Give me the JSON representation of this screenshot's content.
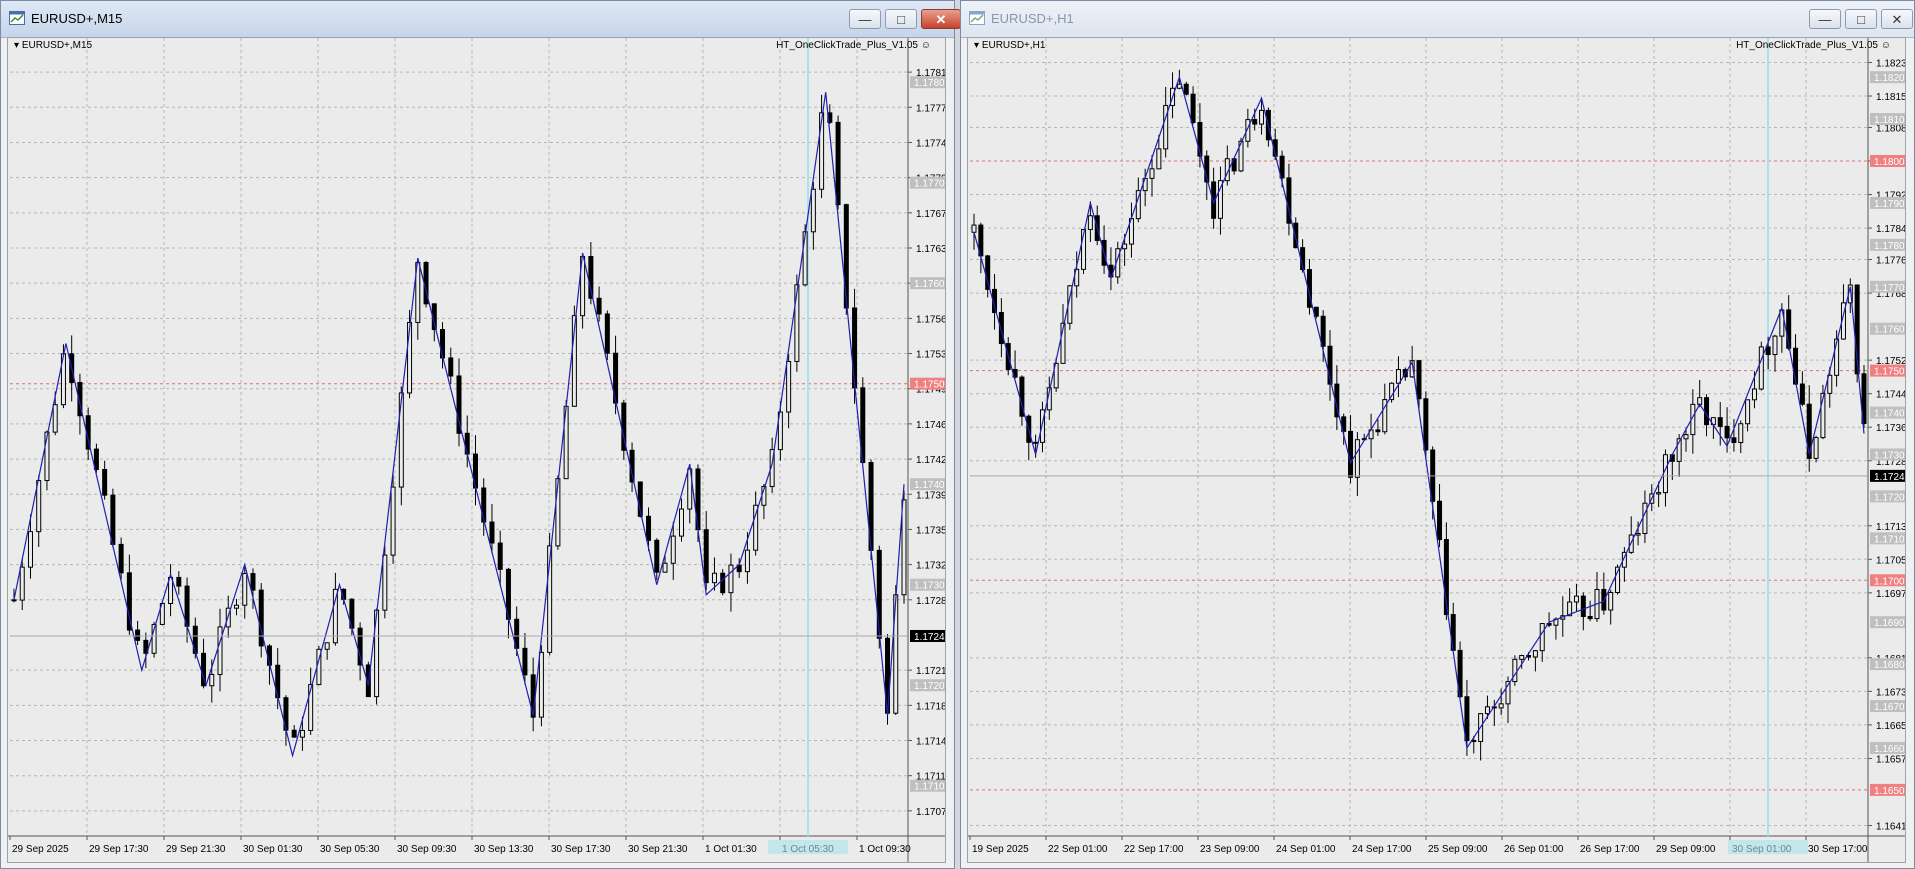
{
  "windows": [
    {
      "title": "EURUSD+,M15",
      "symbol_label": "EURUSD+,M15",
      "ea_label": "HT_OneClickTrade_Plus_V1.05 ☺",
      "active": true,
      "price_labels": [
        "1.17810",
        "1.17775",
        "1.17740",
        "1.17705",
        "1.17670",
        "1.17635",
        "1.17600",
        "1.17565",
        "1.17530",
        "1.17495",
        "1.17460",
        "1.17425",
        "1.17390",
        "1.17355",
        "1.17320",
        "1.17285",
        "1.17215",
        "1.17180",
        "1.17145",
        "1.17110",
        "1.17075"
      ],
      "round_levels": [
        "1.17800",
        "1.17700",
        "1.17600",
        "1.17400",
        "1.17300",
        "1.17200",
        "1.17100"
      ],
      "highlight_level": "1.17500",
      "current_price": "1.17249",
      "time_labels": [
        "29 Sep 2025",
        "29 Sep 17:30",
        "29 Sep 21:30",
        "30 Sep 01:30",
        "30 Sep 05:30",
        "30 Sep 09:30",
        "30 Sep 13:30",
        "30 Sep 17:30",
        "30 Sep 21:30",
        "1 Oct 01:30",
        "1 Oct 05:30",
        "1 Oct 09:30"
      ],
      "chart_data": {
        "type": "line",
        "ylim": [
          1.1705,
          1.1783
        ],
        "zigzag": [
          {
            "x": 0.0,
            "y": 1.17285
          },
          {
            "x": 6.3,
            "y": 1.1754
          },
          {
            "x": 15.5,
            "y": 1.17215
          },
          {
            "x": 19.0,
            "y": 1.1731
          },
          {
            "x": 23.3,
            "y": 1.172
          },
          {
            "x": 28.0,
            "y": 1.1732
          },
          {
            "x": 33.8,
            "y": 1.1713
          },
          {
            "x": 39.5,
            "y": 1.173
          },
          {
            "x": 43.0,
            "y": 1.172
          },
          {
            "x": 49.0,
            "y": 1.17625
          },
          {
            "x": 63.0,
            "y": 1.1717
          },
          {
            "x": 69.0,
            "y": 1.1763
          },
          {
            "x": 78.0,
            "y": 1.173
          },
          {
            "x": 82.0,
            "y": 1.1742
          },
          {
            "x": 84.0,
            "y": 1.1729
          },
          {
            "x": 88.0,
            "y": 1.1732
          },
          {
            "x": 92.0,
            "y": 1.1742
          },
          {
            "x": 98.5,
            "y": 1.1779
          },
          {
            "x": 106.0,
            "y": 1.1717
          },
          {
            "x": 108.0,
            "y": 1.174
          }
        ]
      }
    },
    {
      "title": "EURUSD+,H1",
      "symbol_label": "EURUSD+,H1",
      "ea_label": "HT_OneClickTrade_Plus_V1.05 ☺",
      "active": false,
      "price_labels": [
        "1.18235",
        "1.18155",
        "1.18080",
        "1.18000",
        "1.17920",
        "1.17840",
        "1.17765",
        "1.17685",
        "1.17525",
        "1.17445",
        "1.17365",
        "1.17285",
        "1.17130",
        "1.17050",
        "1.16970",
        "1.16815",
        "1.16735",
        "1.16655",
        "1.16575",
        "1.16415"
      ],
      "round_levels": [
        "1.18200",
        "1.18100",
        "1.17900",
        "1.17800",
        "1.17700",
        "1.17600",
        "1.17400",
        "1.17300",
        "1.17200",
        "1.17100",
        "1.16900",
        "1.16800",
        "1.16700",
        "1.16600"
      ],
      "highlight_levels": [
        "1.18000",
        "1.17500",
        "1.17000",
        "1.16500"
      ],
      "current_price": "1.17249",
      "time_labels": [
        "19 Sep 2025",
        "22 Sep 01:00",
        "22 Sep 17:00",
        "23 Sep 09:00",
        "24 Sep 01:00",
        "24 Sep 17:00",
        "25 Sep 09:00",
        "26 Sep 01:00",
        "26 Sep 17:00",
        "29 Sep 09:00",
        "30 Sep 01:00",
        "30 Sep 17:00"
      ],
      "chart_data": {
        "type": "line",
        "ylim": [
          1.1639,
          1.1826
        ],
        "zigzag": [
          {
            "x": 0.0,
            "y": 1.1783
          },
          {
            "x": 9.0,
            "y": 1.173
          },
          {
            "x": 17.0,
            "y": 1.179
          },
          {
            "x": 20.0,
            "y": 1.1772
          },
          {
            "x": 30.0,
            "y": 1.182
          },
          {
            "x": 35.0,
            "y": 1.179
          },
          {
            "x": 42.0,
            "y": 1.1815
          },
          {
            "x": 55.0,
            "y": 1.1728
          },
          {
            "x": 64.0,
            "y": 1.1752
          },
          {
            "x": 72.0,
            "y": 1.166
          },
          {
            "x": 84.0,
            "y": 1.169
          },
          {
            "x": 92.0,
            "y": 1.1695
          },
          {
            "x": 102.0,
            "y": 1.173
          },
          {
            "x": 106.0,
            "y": 1.1742
          },
          {
            "x": 110.0,
            "y": 1.1732
          },
          {
            "x": 118.0,
            "y": 1.1765
          },
          {
            "x": 122.0,
            "y": 1.173
          },
          {
            "x": 128.0,
            "y": 1.177
          },
          {
            "x": 130.0,
            "y": 1.1735
          }
        ]
      }
    }
  ],
  "colors": {
    "chart_bg": "#ebebeb",
    "grid": "#b7b7b7",
    "candle": "#000000",
    "zigzag": "#1f1fb4",
    "level_line": "#e07070",
    "level_label_bg": "#f08080",
    "round_label_bg": "#bfbfbf",
    "current_label_bg": "#000000",
    "vline": "#a7e3ea"
  },
  "icons": {
    "window": "chart-window-icon",
    "minimize": "minimize-icon",
    "maximize": "maximize-icon",
    "close": "close-icon",
    "dropdown": "triangle-down-icon"
  }
}
